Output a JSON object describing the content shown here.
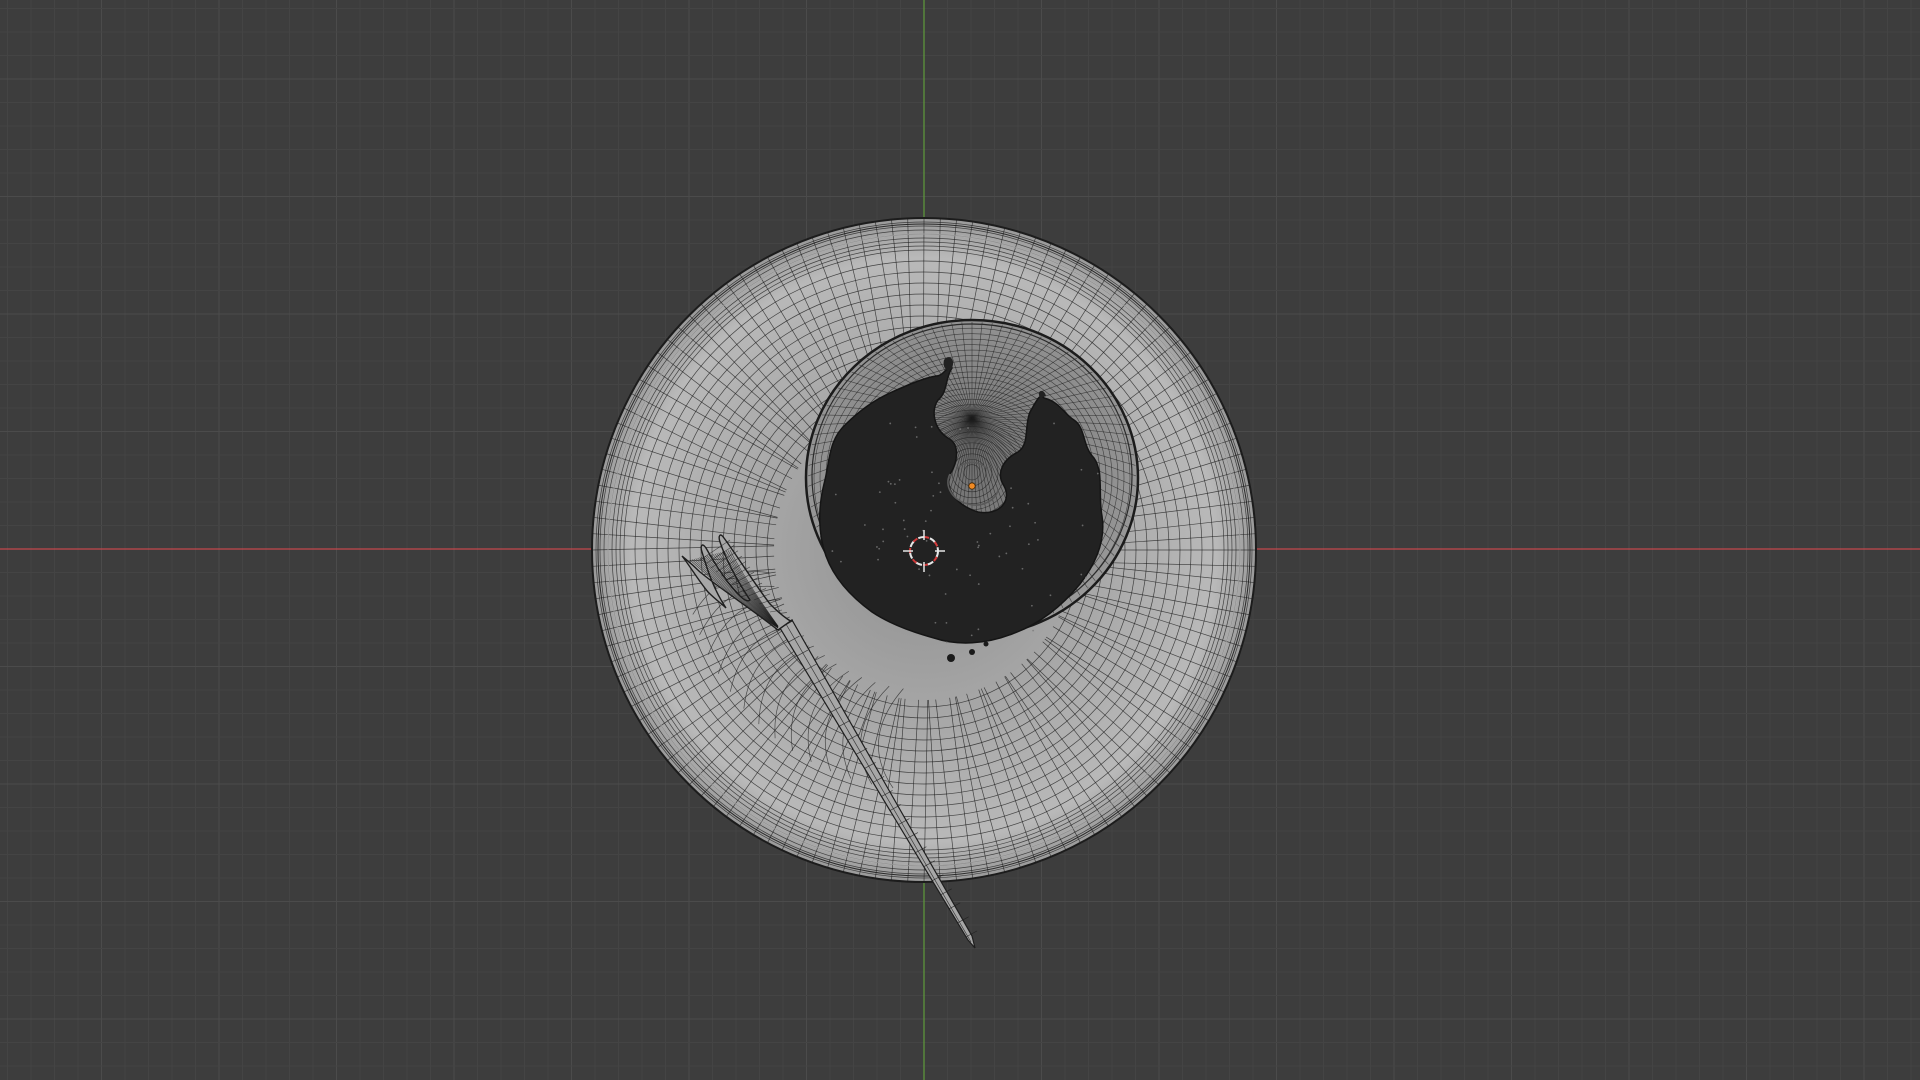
{
  "viewport": {
    "background": "#3d3d3d",
    "grid_minor_color": "#444444",
    "grid_major_color": "#4b4b4b",
    "x_axis_color": "#c4474d",
    "y_axis_color": "#5f9b3b",
    "view": "top-orthographic"
  },
  "scene": {
    "objects": [
      {
        "name": "plate",
        "type": "mesh",
        "display": "wireframe-on-solid"
      },
      {
        "name": "food",
        "type": "mesh",
        "display": "solid-dark"
      },
      {
        "name": "fork",
        "type": "mesh",
        "display": "wireframe-on-solid"
      }
    ],
    "plate_color": "#b3b3b3",
    "wire_color": "#1e1e1e",
    "food_color": "#202020",
    "cursor_icon": "3d-cursor-icon",
    "origin_color": "#f08a24"
  }
}
